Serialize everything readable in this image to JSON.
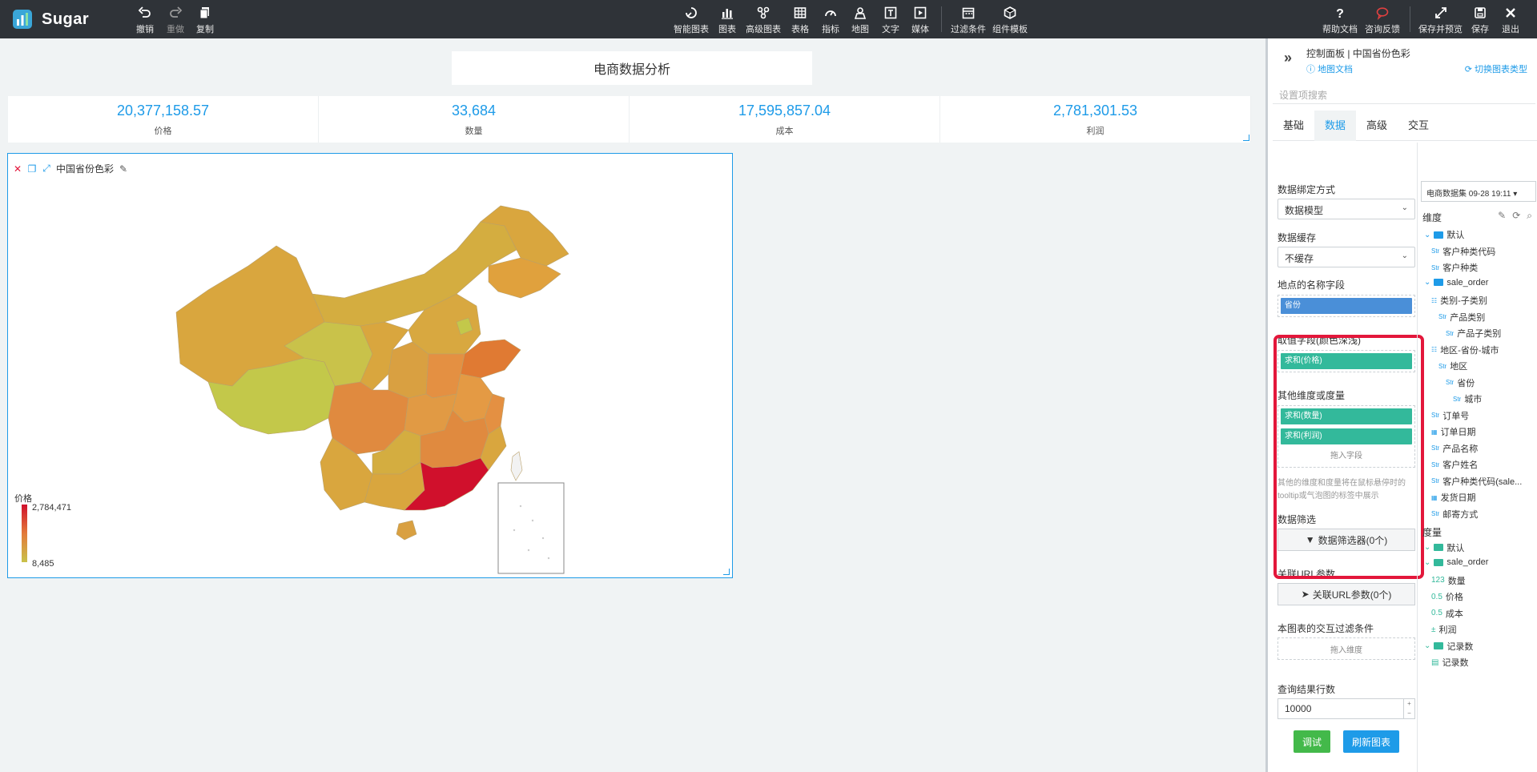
{
  "app": {
    "name": "Sugar"
  },
  "toolbar": {
    "left": [
      {
        "id": "undo",
        "label": "撤销",
        "icon": "undo-icon"
      },
      {
        "id": "redo",
        "label": "重做",
        "icon": "redo-icon"
      },
      {
        "id": "copy",
        "label": "复制",
        "icon": "copy-icon"
      }
    ],
    "center": [
      {
        "id": "smart",
        "label": "智能图表",
        "icon": "smart-chart-icon"
      },
      {
        "id": "chart",
        "label": "图表",
        "icon": "bar-chart-icon"
      },
      {
        "id": "adv",
        "label": "高级图表",
        "icon": "advanced-chart-icon"
      },
      {
        "id": "table",
        "label": "表格",
        "icon": "table-icon"
      },
      {
        "id": "metric",
        "label": "指标",
        "icon": "gauge-icon"
      },
      {
        "id": "map",
        "label": "地图",
        "icon": "map-icon"
      },
      {
        "id": "text",
        "label": "文字",
        "icon": "text-icon"
      },
      {
        "id": "media",
        "label": "媒体",
        "icon": "media-icon"
      },
      {
        "id": "filter",
        "label": "过滤条件",
        "icon": "filter-calendar-icon"
      },
      {
        "id": "template",
        "label": "组件模板",
        "icon": "template-icon"
      }
    ],
    "right": [
      {
        "id": "help",
        "label": "帮助文档",
        "icon": "help-icon"
      },
      {
        "id": "feedback",
        "label": "咨询反馈",
        "icon": "feedback-icon"
      },
      {
        "id": "preview",
        "label": "保存并预览",
        "icon": "expand-icon"
      },
      {
        "id": "save",
        "label": "保存",
        "icon": "save-icon"
      },
      {
        "id": "exit",
        "label": "退出",
        "icon": "close-icon"
      }
    ]
  },
  "dashboard": {
    "title": "电商数据分析",
    "kpis": [
      {
        "value": "20,377,158.57",
        "label": "价格"
      },
      {
        "value": "33,684",
        "label": "数量"
      },
      {
        "value": "17,595,857.04",
        "label": "成本"
      },
      {
        "value": "2,781,301.53",
        "label": "利润"
      }
    ],
    "map": {
      "title": "中国省份色彩",
      "legend_title": "价格",
      "legend_max": "2,784,471",
      "legend_min": "8,485",
      "colors": {
        "high": "#d0102c",
        "mid": "#e37a3a",
        "low": "#c9c24a"
      }
    }
  },
  "panel": {
    "title": "控制面板 | 中国省份色彩",
    "doc_link": "地图文档",
    "switch_link": "切换图表类型",
    "search_placeholder": "设置项搜索",
    "tabs": [
      "基础",
      "数据",
      "高级",
      "交互"
    ],
    "active_tab": "数据",
    "binding_label": "数据绑定方式",
    "binding_value": "数据模型",
    "cache_label": "数据缓存",
    "cache_value": "不缓存",
    "name_field_label": "地点的名称字段",
    "name_field_pill": "省份",
    "value_field_label": "取值字段(颜色深浅)",
    "value_field_pill": "求和(价格)",
    "other_label": "其他维度或度量",
    "other_pills": [
      "求和(数量)",
      "求和(利润)"
    ],
    "drop_hint": "拖入字段",
    "other_note": "其他的维度和度量将在鼠标悬停时的tooltip或气泡图的标签中展示",
    "filter_label": "数据筛选",
    "filter_button": "数据筛选器(0个)",
    "url_label": "关联URL参数",
    "url_button": "关联URL参数(0个)",
    "interaction_label": "本图表的交互过滤条件",
    "interaction_hint": "拖入维度",
    "rows_label": "查询结果行数",
    "rows_value": "10000",
    "debug_button": "调试",
    "refresh_button": "刷新图表"
  },
  "dataset": {
    "name": "电商数据集 09-28 19:11",
    "dimension_label": "度",
    "dimension_title": "维度",
    "measure_title": "度量",
    "dimensions": [
      {
        "label": "默认",
        "type": "folder",
        "depth": 0
      },
      {
        "label": "客户种类代码",
        "type": "str",
        "depth": 1
      },
      {
        "label": "客户种类",
        "type": "str",
        "depth": 1
      },
      {
        "label": "sale_order",
        "type": "folder",
        "depth": 0
      },
      {
        "label": "类别-子类别",
        "type": "hier",
        "depth": 1
      },
      {
        "label": "产品类别",
        "type": "str",
        "depth": 2
      },
      {
        "label": "产品子类别",
        "type": "str",
        "depth": 3
      },
      {
        "label": "地区-省份-城市",
        "type": "hier",
        "depth": 1
      },
      {
        "label": "地区",
        "type": "str",
        "depth": 2
      },
      {
        "label": "省份",
        "type": "str",
        "depth": 3
      },
      {
        "label": "城市",
        "type": "str",
        "depth": 4
      },
      {
        "label": "订单号",
        "type": "str",
        "depth": 1
      },
      {
        "label": "订单日期",
        "type": "date",
        "depth": 1
      },
      {
        "label": "产品名称",
        "type": "str",
        "depth": 1
      },
      {
        "label": "客户姓名",
        "type": "str",
        "depth": 1
      },
      {
        "label": "客户种类代码(sale...",
        "type": "str",
        "depth": 1
      },
      {
        "label": "发货日期",
        "type": "date",
        "depth": 1
      },
      {
        "label": "邮寄方式",
        "type": "str",
        "depth": 1
      }
    ],
    "measures": [
      {
        "label": "默认",
        "type": "folder",
        "depth": 0
      },
      {
        "label": "sale_order",
        "type": "folder",
        "depth": 0
      },
      {
        "label": "数量",
        "type": "int",
        "depth": 1
      },
      {
        "label": "价格",
        "type": "float",
        "depth": 1
      },
      {
        "label": "成本",
        "type": "float",
        "depth": 1
      },
      {
        "label": "利润",
        "type": "calc",
        "depth": 1
      },
      {
        "label": "记录数",
        "type": "folder",
        "depth": 0
      },
      {
        "label": "记录数",
        "type": "count",
        "depth": 1
      }
    ]
  }
}
